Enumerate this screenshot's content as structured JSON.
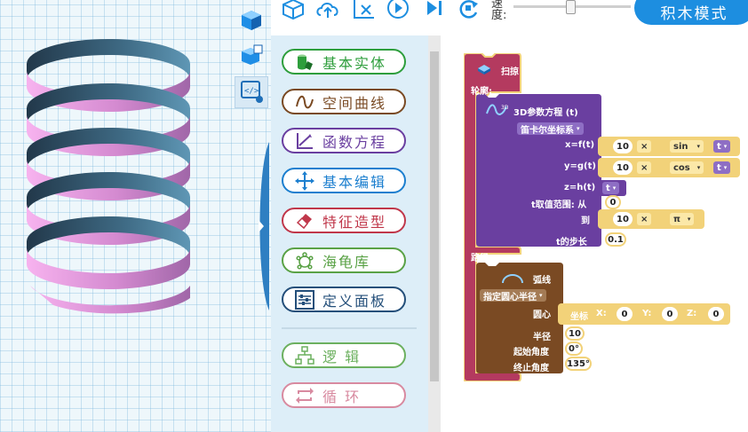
{
  "toolbar": {
    "icons": [
      "cube-icon",
      "cloud-upload-icon",
      "clear-icon",
      "play-icon",
      "step-icon",
      "reset-icon"
    ],
    "speed_label": "速度:",
    "speed_value": 0.45,
    "mode_button": "积木模式"
  },
  "view_tools": [
    "cube-view-icon",
    "cube-edit-icon",
    "code-icon"
  ],
  "palette": {
    "categories": [
      {
        "label": "基本实体",
        "color": "#2e9e3c",
        "icon": "cylinder-icon"
      },
      {
        "label": "空间曲线",
        "color": "#7a4a23",
        "icon": "curve-icon"
      },
      {
        "label": "函数方程",
        "color": "#6a3fa0",
        "icon": "axes-icon"
      },
      {
        "label": "基本编辑",
        "color": "#1c7fcf",
        "icon": "move-arrows-icon"
      },
      {
        "label": "特征造型",
        "color": "#c0374a",
        "icon": "eraser-icon"
      },
      {
        "label": "海龟库",
        "color": "#5aa246",
        "icon": "turtle-icon"
      },
      {
        "label": "定义面板",
        "color": "#244f7a",
        "icon": "sliders-icon"
      },
      {
        "label": "逻    辑",
        "color": "#6cb05f",
        "icon": "logic-tree-icon"
      },
      {
        "label": "循    环",
        "color": "#d88aa0",
        "icon": "loop-icon"
      }
    ]
  },
  "blocks": {
    "sweep": {
      "title": "扫掠",
      "profile_label": "轮廓:",
      "path_label": "路径:"
    },
    "param": {
      "title": "3D参数方程 (t)",
      "coord_system": "笛卡尔坐标系",
      "x_label": "x=f(t)",
      "y_label": "y=g(t)",
      "z_label": "z=h(t)",
      "t_from_label": "t取值范围: 从",
      "t_to_label": "到",
      "step_label": "t的步长",
      "x_num": "10",
      "x_op": "×",
      "x_fn": "sin",
      "x_var": "t",
      "y_num": "10",
      "y_op": "×",
      "y_fn": "cos",
      "y_var": "t",
      "z_var": "t",
      "t_from": "0",
      "t_to_num": "10",
      "t_to_op": "×",
      "t_to_const": "π",
      "step": "0.1"
    },
    "arc": {
      "title": "弧线",
      "mode": "指定圆心半径",
      "center_label": "圆心",
      "coord_label": "坐标",
      "x_label": "X:",
      "x": "0",
      "y_label": "Y:",
      "y": "0",
      "z_label": "Z:",
      "z": "0",
      "radius_label": "半径",
      "radius": "10",
      "start_label": "起始角度",
      "start": "0°",
      "end_label": "终止角度",
      "end": "135°"
    }
  }
}
